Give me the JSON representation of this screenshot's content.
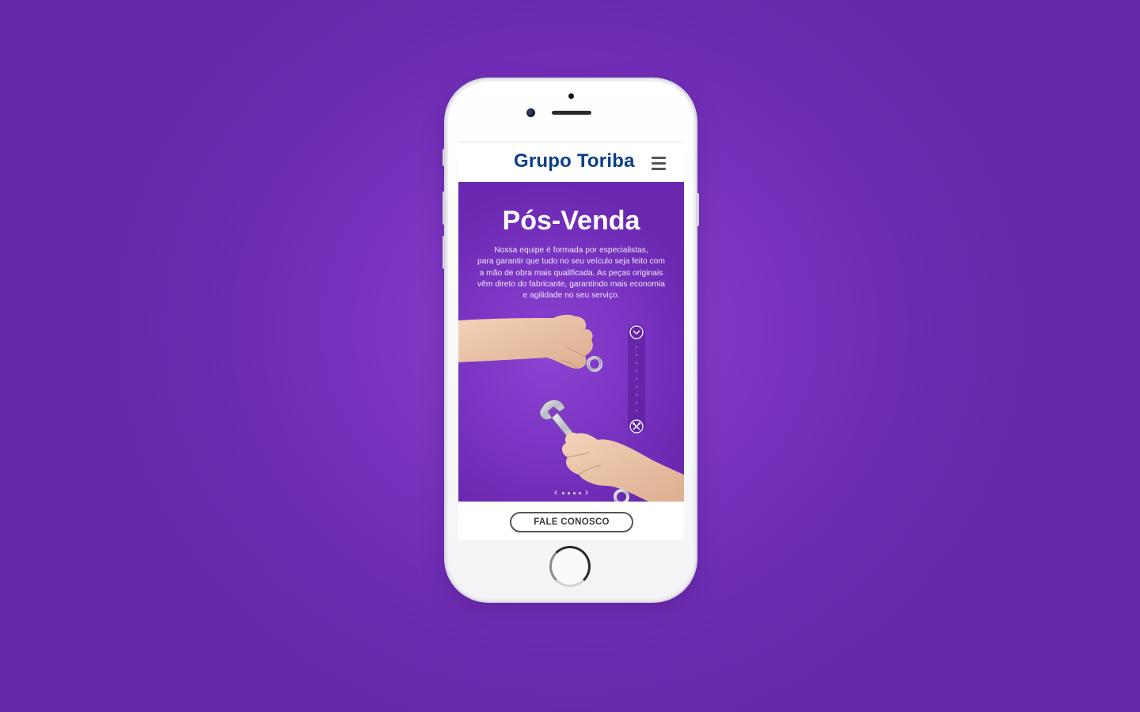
{
  "app": {
    "brand": "Grupo Toriba"
  },
  "hero": {
    "title": "Pós-Venda",
    "text_lines": [
      "Nossa equipe é formada por especialistas,",
      "para garantir que tudo no seu veículo seja feito com",
      "a mão de obra mais qualificada.  As peças originais",
      "vêm direto do fabricante, garantindo mais economia",
      "e agilidade no seu serviço."
    ]
  },
  "carousel": {
    "prev_arrow": "‹",
    "next_arrow": "›",
    "slide_count": 4,
    "active_index": 0
  },
  "cta": {
    "label": "FALE CONOSCO"
  },
  "icons": {
    "menu": "hamburger-menu-icon",
    "scroll_down": "chevron-down-circle-icon",
    "tools": "wrench-screwdriver-icon"
  },
  "colors": {
    "background": "#7a34c0",
    "brand": "#0a3d8a",
    "hero": "#7a34c2",
    "button_border": "#55555a"
  }
}
